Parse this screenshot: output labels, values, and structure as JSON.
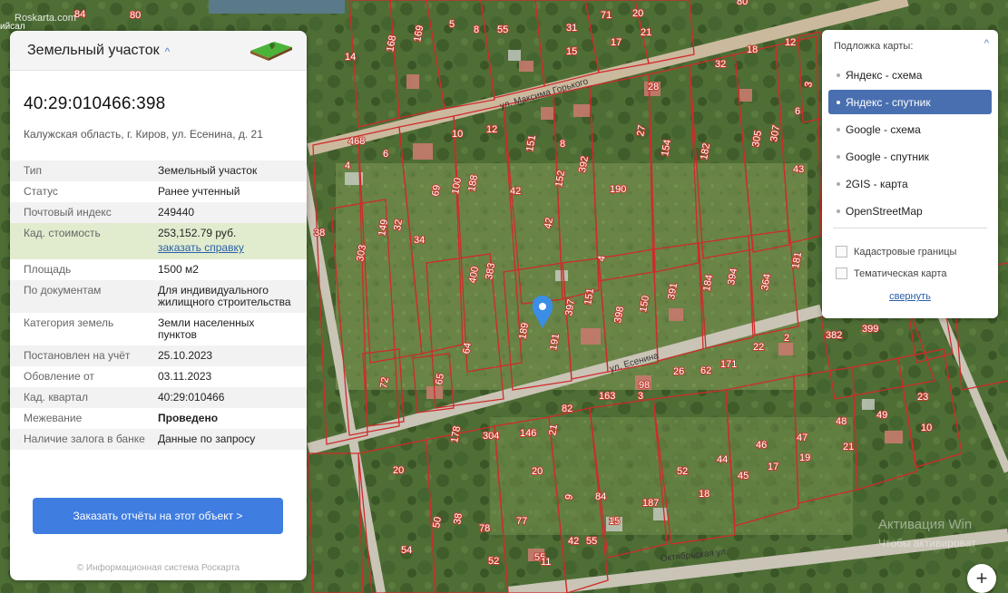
{
  "panel": {
    "title": "Земельный участок",
    "cad_number": "40:29:010466:398",
    "address": "Калужская область, г. Киров, ул. Есенина, д. 21",
    "rows": [
      {
        "key": "Тип",
        "value": "Земельный участок"
      },
      {
        "key": "Статус",
        "value": "Ранее учтенный"
      },
      {
        "key": "Почтовый индекс",
        "value": "249440"
      },
      {
        "key": "Кад. стоимость",
        "value": "253,152.79 руб.",
        "link": "заказать справку"
      },
      {
        "key": "Площадь",
        "value": "1500 м2"
      },
      {
        "key": "По документам",
        "value": "Для индивидуального жилищного строительства"
      },
      {
        "key": "Категория земель",
        "value": "Земли населенных пунктов"
      },
      {
        "key": "Постановлен на учёт",
        "value": "25.10.2023"
      },
      {
        "key": "Обовление от",
        "value": "03.11.2023"
      },
      {
        "key": "Кад. квартал",
        "value": "40:29:010466"
      },
      {
        "key": "Межевание",
        "value": "Проведено"
      },
      {
        "key": "Наличие залога в банке",
        "value": "Данные по запросу"
      }
    ],
    "order_button": "Заказать отчёты на этот объект >",
    "copyright": "© Информационная система Роскарта"
  },
  "layers": {
    "title": "Подложка карты:",
    "items": [
      "Яндекс - схема",
      "Яндекс - спутник",
      "Google - схема",
      "Google - спутник",
      "2GIS - карта",
      "OpenStreetMap"
    ],
    "active": "Яндекс - спутник",
    "checks": [
      "Кадастровые границы",
      "Тематическая карта"
    ],
    "collapse": "свернуть"
  },
  "map": {
    "zoom_in": "+",
    "top_left_text": "Roskarta.com",
    "top_left_text2": "ийсал",
    "watermark_1": "Активация Win",
    "watermark_2": "Чтобы активироват",
    "streets": [
      "ул. Максима Горького",
      "ул. Есенина",
      "Октябрьская ул."
    ],
    "plot_numbers": [
      "80",
      "84",
      "14",
      "168",
      "169",
      "5",
      "8",
      "55",
      "31",
      "15",
      "20",
      "21",
      "17",
      "80",
      "71",
      "468",
      "4",
      "6",
      "10",
      "12",
      "42",
      "8",
      "392",
      "151",
      "152",
      "27",
      "154",
      "182",
      "305",
      "307",
      "43",
      "28",
      "32",
      "18",
      "12",
      "3",
      "6",
      "38",
      "303",
      "149",
      "32",
      "34",
      "69",
      "100",
      "188",
      "190",
      "42",
      "4",
      "151",
      "391",
      "184",
      "394",
      "364",
      "181",
      "400",
      "383",
      "189",
      "191",
      "397",
      "398",
      "150",
      "382",
      "399",
      "2",
      "22",
      "62",
      "171",
      "26",
      "98",
      "3",
      "163",
      "82",
      "64",
      "65",
      "72",
      "178",
      "304",
      "146",
      "21",
      "20",
      "20",
      "9",
      "84",
      "187",
      "52",
      "44",
      "45",
      "46",
      "17",
      "47",
      "19",
      "48",
      "21",
      "49",
      "23",
      "10",
      "50",
      "38",
      "78",
      "77",
      "54",
      "55",
      "11",
      "42",
      "55",
      "18",
      "52",
      "15",
      "5",
      "11"
    ],
    "pin_color": "#3b8ee6"
  }
}
